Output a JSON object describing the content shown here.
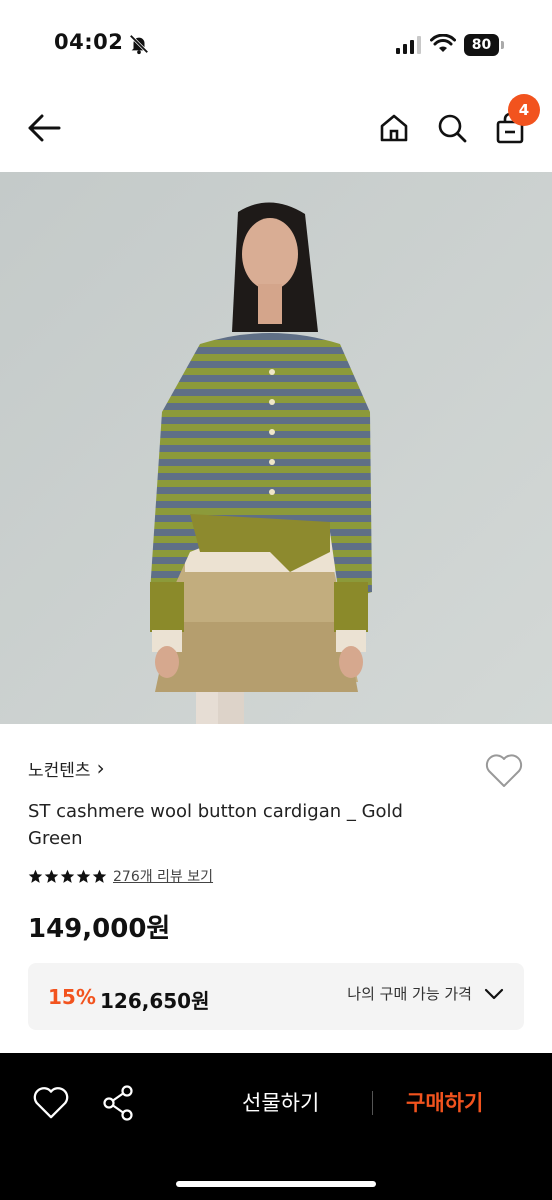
{
  "status_bar": {
    "time": "04:02",
    "battery": "80"
  },
  "nav": {
    "cart_count": "4"
  },
  "product": {
    "brand": "노컨텐츠",
    "brand_chevron": "›",
    "title": "ST cashmere wool button cardigan _ Gold Green",
    "rating": 5,
    "review_link": "276개 리뷰 보기",
    "price": "149,000원",
    "discount_rate": "15%",
    "discount_price": "126,650원",
    "my_price_label": "나의 구매 가능 가격"
  },
  "bottom_bar": {
    "gift_label": "선물하기",
    "buy_label": "구매하기"
  },
  "colors": {
    "accent": "#f2531e",
    "bottom_bar_bg": "#000000",
    "discount_box_bg": "#f4f4f4"
  },
  "icons": [
    "bell-off-icon",
    "signal-icon",
    "wifi-icon",
    "battery-icon",
    "back-arrow-icon",
    "home-icon",
    "search-icon",
    "cart-icon",
    "heart-icon",
    "star-icon",
    "chevron-down-icon",
    "share-icon"
  ]
}
